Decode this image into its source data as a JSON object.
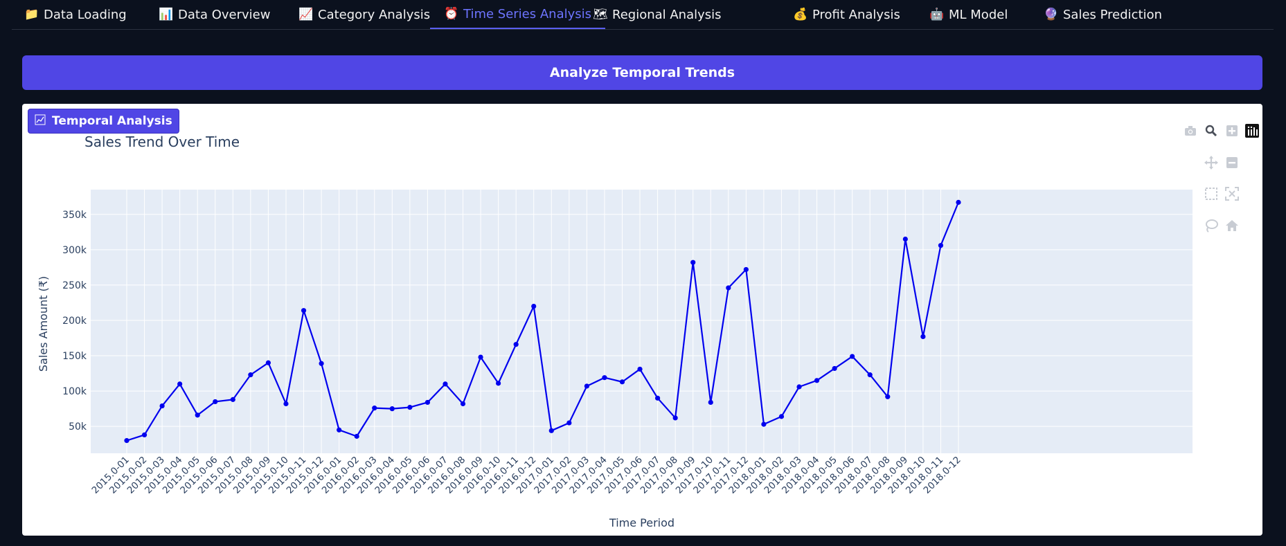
{
  "tabs": [
    {
      "icon": "folder-icon",
      "glyph": "📁",
      "label": "Data Loading",
      "active": false
    },
    {
      "icon": "bar-chart-icon",
      "glyph": "📊",
      "label": "Data Overview",
      "active": false
    },
    {
      "icon": "trend-chart-icon",
      "glyph": "📈",
      "label": "Category Analysis",
      "active": false
    },
    {
      "icon": "alarm-clock-icon",
      "glyph": "⏰",
      "label": "Time Series Analysis",
      "active": true
    },
    {
      "icon": "map-icon",
      "glyph": "🗺",
      "label": "Regional Analysis",
      "active": false
    },
    {
      "icon": "money-bag-icon",
      "glyph": "💰",
      "label": "Profit Analysis",
      "active": false
    },
    {
      "icon": "robot-icon",
      "glyph": "🤖",
      "label": "ML Model",
      "active": false
    },
    {
      "icon": "crystal-ball-icon",
      "glyph": "🔮",
      "label": "Sales Prediction",
      "active": false
    }
  ],
  "analyze_button": {
    "label": "Analyze Temporal Trends",
    "color": "#5046e5"
  },
  "section_badge": {
    "label": "Temporal Analysis",
    "icon": "scatter-chart-icon"
  },
  "modebar": [
    "camera-icon",
    "zoom-icon",
    "zoom-in-icon",
    "plotly-logo-icon",
    "pan-icon",
    "zoom-out-icon",
    "box-select-icon",
    "autoscale-icon",
    "lasso-select-icon",
    "reset-axes-home-icon"
  ],
  "chart_data": {
    "type": "line",
    "title": "Sales Trend Over Time",
    "xlabel": "Time Period",
    "ylabel": "Sales Amount (₹)",
    "ylim": [
      12000,
      385000
    ],
    "yticks": [
      50000,
      100000,
      150000,
      200000,
      250000,
      300000,
      350000
    ],
    "ytick_labels": [
      "50k",
      "100k",
      "150k",
      "200k",
      "250k",
      "300k",
      "350k"
    ],
    "grid": true,
    "line_color": "#0000ee",
    "plot_bg": "#e5ecf6",
    "series": [
      {
        "x": [
          "2015.0-01",
          "2015.0-02",
          "2015.0-03",
          "2015.0-04",
          "2015.0-05",
          "2015.0-06",
          "2015.0-07",
          "2015.0-08",
          "2015.0-09",
          "2015.0-10",
          "2015.0-11",
          "2015.0-12",
          "2016.0-01",
          "2016.0-02",
          "2016.0-03",
          "2016.0-04",
          "2016.0-05",
          "2016.0-06",
          "2016.0-07",
          "2016.0-08",
          "2016.0-09",
          "2016.0-10",
          "2016.0-11",
          "2016.0-12",
          "2017.0-01",
          "2017.0-02",
          "2017.0-03",
          "2017.0-04",
          "2017.0-05",
          "2017.0-06",
          "2017.0-07",
          "2017.0-08",
          "2017.0-09",
          "2017.0-10",
          "2017.0-11",
          "2017.0-12",
          "2018.0-01",
          "2018.0-02",
          "2018.0-03",
          "2018.0-04",
          "2018.0-05",
          "2018.0-06",
          "2018.0-07",
          "2018.0-08",
          "2018.0-09",
          "2018.0-10",
          "2018.0-11",
          "2018.0-12"
        ],
        "y": [
          30000,
          38000,
          79000,
          110000,
          66000,
          85000,
          88000,
          123000,
          140000,
          82000,
          214000,
          139000,
          45000,
          36000,
          76000,
          75000,
          77000,
          84000,
          110000,
          82000,
          148000,
          111000,
          166000,
          220000,
          44000,
          55000,
          107000,
          119000,
          113000,
          131000,
          90000,
          62000,
          282000,
          84000,
          246000,
          272000,
          53000,
          64000,
          106000,
          115000,
          132000,
          149000,
          123000,
          92000,
          315000,
          177000,
          306000,
          367000
        ]
      }
    ]
  }
}
